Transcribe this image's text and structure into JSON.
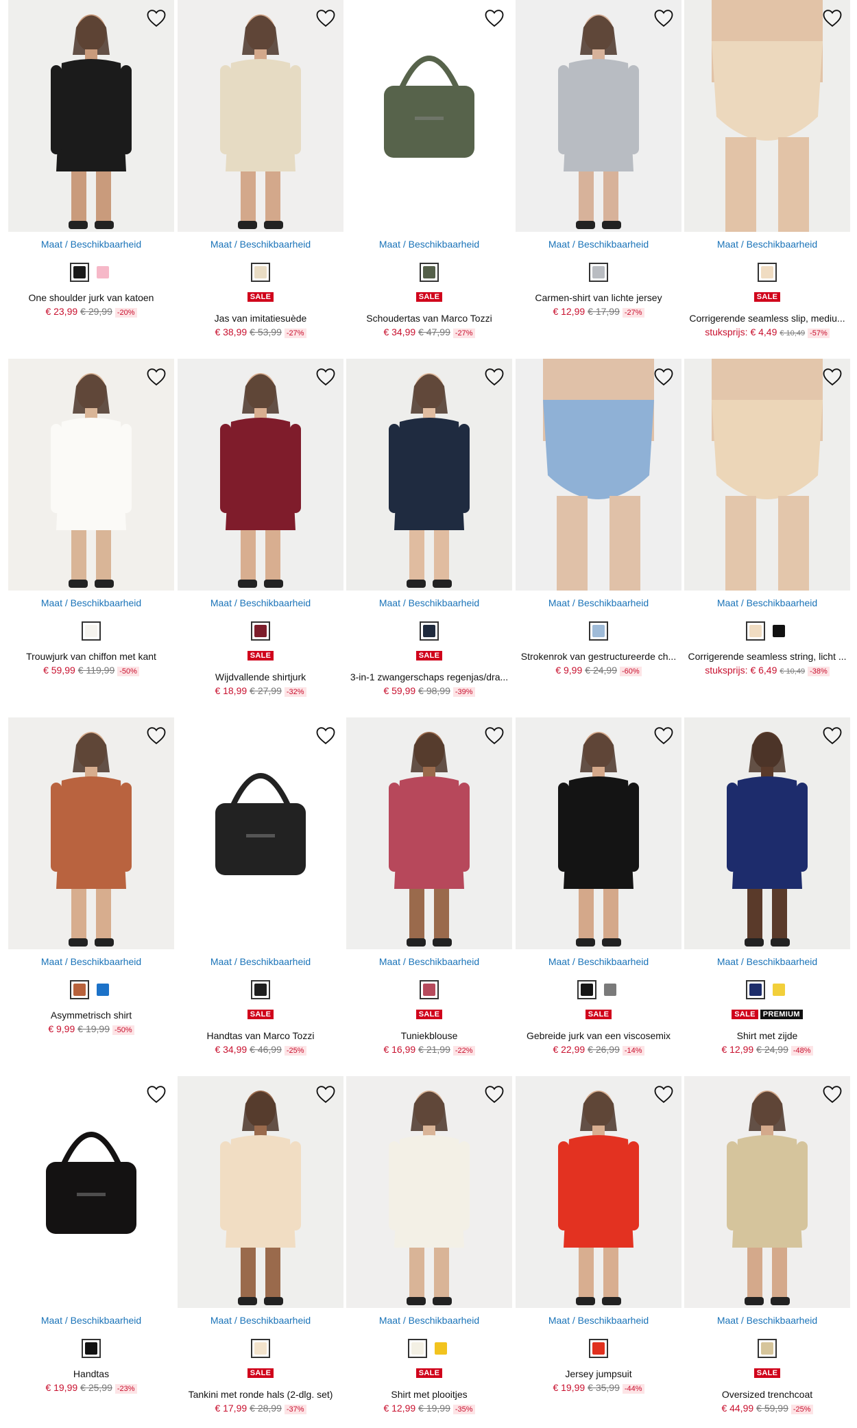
{
  "common": {
    "maat_label": "Maat / Beschikbaarheid",
    "sale_label": "SALE",
    "premium_label": "PREMIUM"
  },
  "products": [
    {
      "name": "One shoulder jurk van katoen",
      "price": "€ 23,99",
      "old_price": "€ 29,99",
      "discount": "-20%",
      "sale": false,
      "icon": "dress-photo",
      "colors": [
        "#1a1a1a",
        "#f6b8c8"
      ],
      "bg": "#efefed",
      "garment": "#1b1b1b",
      "skin": "#c99b7c",
      "kind": "model"
    },
    {
      "name": "Jas van imitatiesuède",
      "price": "€ 38,99",
      "old_price": "€ 53,99",
      "discount": "-27%",
      "sale": true,
      "icon": "jacket-photo",
      "colors": [
        "#e9dcc4"
      ],
      "bg": "#f0efee",
      "garment": "#e6dbc3",
      "skin": "#d3a88b",
      "kind": "model"
    },
    {
      "name": "Schoudertas van Marco Tozzi",
      "price": "€ 34,99",
      "old_price": "€ 47,99",
      "discount": "-27%",
      "sale": true,
      "icon": "bag-photo",
      "colors": [
        "#55604a"
      ],
      "bg": "#ffffff",
      "garment": "#57634b",
      "skin": "#57634b",
      "kind": "bag"
    },
    {
      "name": "Carmen-shirt van lichte jersey",
      "price": "€ 12,99",
      "old_price": "€ 17,99",
      "discount": "-27%",
      "sale": false,
      "icon": "shirt-photo",
      "colors": [
        "#b9bcc1"
      ],
      "bg": "#efefef",
      "garment": "#b8bcc2",
      "skin": "#d7b29a",
      "kind": "model"
    },
    {
      "name": "Corrigerende seamless slip, mediu...",
      "price_label": "stuksprijs:",
      "price": "€ 4,49",
      "old_price": "€ 10,49",
      "discount": "-57%",
      "sale": true,
      "icon": "slip-photo",
      "colors": [
        "#f0dcc2"
      ],
      "bg": "#eeeeec",
      "garment": "#ecd8bd",
      "skin": "#e2c3a7",
      "kind": "lower"
    },
    {
      "name": "Trouwjurk van chiffon met kant",
      "price": "€ 59,99",
      "old_price": "€ 119,99",
      "discount": "-50%",
      "sale": false,
      "icon": "wedding-dress-photo",
      "colors": [
        "#f6f4ef"
      ],
      "bg": "#f2f0ec",
      "garment": "#fbfaf7",
      "skin": "#d9b597",
      "kind": "model"
    },
    {
      "name": "Wijdvallende shirtjurk",
      "price": "€ 18,99",
      "old_price": "€ 27,99",
      "discount": "-32%",
      "sale": true,
      "icon": "shirtdress-photo",
      "colors": [
        "#7d1d2b"
      ],
      "bg": "#efefee",
      "garment": "#7f1c2b",
      "skin": "#d8ae90",
      "kind": "model"
    },
    {
      "name": "3-in-1 zwangerschaps regenjas/dra...",
      "price": "€ 59,99",
      "old_price": "€ 98,99",
      "discount": "-39%",
      "sale": true,
      "icon": "raincoat-photo",
      "colors": [
        "#1f2a3d"
      ],
      "bg": "#eeeeec",
      "garment": "#1f2b40",
      "skin": "#e0bca0",
      "kind": "model"
    },
    {
      "name": "Strokenrok van gestructureerde ch...",
      "price": "€ 9,99",
      "old_price": "€ 24,99",
      "discount": "-60%",
      "sale": false,
      "icon": "skirt-photo",
      "colors": [
        "#9fbbd8"
      ],
      "bg": "#efefef",
      "garment": "#8fb1d6",
      "skin": "#e0c1a8",
      "kind": "lower"
    },
    {
      "name": "Corrigerende seamless string, licht ...",
      "price_label": "stuksprijs:",
      "price": "€ 6,49",
      "old_price": "€ 10,49",
      "discount": "-38%",
      "sale": false,
      "icon": "string-photo",
      "colors": [
        "#f0dcc2",
        "#111111"
      ],
      "bg": "#eeeeec",
      "garment": "#ecd6b8",
      "skin": "#e3c6ab",
      "kind": "lower"
    },
    {
      "name": "Asymmetrisch shirt",
      "price": "€ 9,99",
      "old_price": "€ 19,99",
      "discount": "-50%",
      "sale": false,
      "icon": "asym-shirt-photo",
      "colors": [
        "#b8623c",
        "#1c72c8"
      ],
      "bg": "#f0efed",
      "garment": "#b9633f",
      "skin": "#d7ad8e",
      "kind": "model"
    },
    {
      "name": "Handtas van Marco Tozzi",
      "price": "€ 34,99",
      "old_price": "€ 46,99",
      "discount": "-25%",
      "sale": true,
      "icon": "handbag-photo",
      "colors": [
        "#1e1e1e"
      ],
      "bg": "#ffffff",
      "garment": "#222222",
      "skin": "#222222",
      "kind": "bag"
    },
    {
      "name": "Tuniekblouse",
      "price": "€ 16,99",
      "old_price": "€ 21,99",
      "discount": "-22%",
      "sale": true,
      "icon": "blouse-photo",
      "colors": [
        "#b64a5c"
      ],
      "bg": "#efefee",
      "garment": "#b7485b",
      "skin": "#9a6a4c",
      "kind": "model"
    },
    {
      "name": "Gebreide jurk van een viscosemix",
      "price": "€ 22,99",
      "old_price": "€ 26,99",
      "discount": "-14%",
      "sale": true,
      "icon": "knit-dress-photo",
      "colors": [
        "#151515",
        "#7a7a7a"
      ],
      "bg": "#efefee",
      "garment": "#141414",
      "skin": "#d4a88a",
      "kind": "model"
    },
    {
      "name": "Shirt met zijde",
      "price": "€ 12,99",
      "old_price": "€ 24,99",
      "discount": "-48%",
      "sale": true,
      "premium": true,
      "icon": "silk-shirt-photo",
      "colors": [
        "#1d2d6b",
        "#f2cf3a"
      ],
      "bg": "#eeeeec",
      "garment": "#1d2c6c",
      "skin": "#5a3a2a",
      "kind": "model"
    },
    {
      "name": "Handtas",
      "price": "€ 19,99",
      "old_price": "€ 25,99",
      "discount": "-23%",
      "sale": false,
      "icon": "suede-bag-photo",
      "colors": [
        "#111111"
      ],
      "bg": "#ffffff",
      "garment": "#141212",
      "skin": "#141212",
      "kind": "bag"
    },
    {
      "name": "Tankini met ronde hals (2-dlg. set)",
      "price": "€ 17,99",
      "old_price": "€ 28,99",
      "discount": "-37%",
      "sale": true,
      "icon": "tankini-photo",
      "colors": [
        "#f3e3cc"
      ],
      "bg": "#efefed",
      "garment": "#f1ddc3",
      "skin": "#9a6a4c",
      "kind": "model"
    },
    {
      "name": "Shirt met plooitjes",
      "price": "€ 12,99",
      "old_price": "€ 19,99",
      "discount": "-35%",
      "sale": true,
      "icon": "pleat-shirt-photo",
      "colors": [
        "#f3f0e4",
        "#f2c31e"
      ],
      "bg": "#f0efee",
      "garment": "#f3f0e6",
      "skin": "#d9b497",
      "kind": "model"
    },
    {
      "name": "Jersey jumpsuit",
      "price": "€ 19,99",
      "old_price": "€ 35,99",
      "discount": "-44%",
      "sale": false,
      "icon": "jumpsuit-photo",
      "colors": [
        "#e0301e"
      ],
      "bg": "#efefee",
      "garment": "#e33221",
      "skin": "#d8ae90",
      "kind": "model"
    },
    {
      "name": "Oversized trenchcoat",
      "price": "€ 44,99",
      "old_price": "€ 59,99",
      "discount": "-25%",
      "sale": true,
      "icon": "trenchcoat-photo",
      "colors": [
        "#d6c59b"
      ],
      "bg": "#f0efee",
      "garment": "#d5c49c",
      "skin": "#d4a98b",
      "kind": "model"
    }
  ]
}
